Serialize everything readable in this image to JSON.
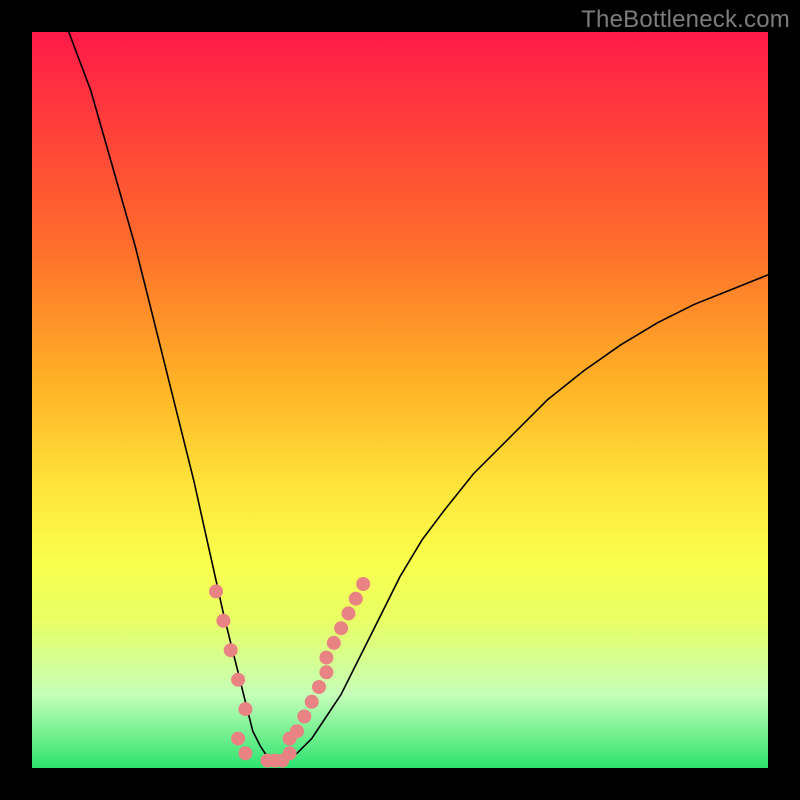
{
  "watermark": "TheBottleneck.com",
  "chart_data": {
    "type": "line",
    "title": "",
    "xlabel": "",
    "ylabel": "",
    "xlim": [
      0,
      100
    ],
    "ylim": [
      0,
      100
    ],
    "curve": {
      "name": "bottleneck-curve",
      "x": [
        5,
        8,
        10,
        12,
        14,
        16,
        18,
        20,
        22,
        24,
        26,
        27,
        28,
        29,
        30,
        31,
        32,
        33,
        34,
        35,
        36,
        38,
        40,
        42,
        44,
        46,
        48,
        50,
        53,
        56,
        60,
        65,
        70,
        75,
        80,
        85,
        90,
        95,
        100
      ],
      "y": [
        100,
        92,
        85,
        78,
        71,
        63,
        55,
        47,
        39,
        30,
        21,
        17,
        13,
        9,
        5,
        3,
        1.5,
        1,
        1,
        1.3,
        2,
        4,
        7,
        10,
        14,
        18,
        22,
        26,
        31,
        35,
        40,
        45,
        50,
        54,
        57.5,
        60.5,
        63,
        65,
        67
      ]
    },
    "markers": {
      "name": "salmon-dots",
      "color": "#e98383",
      "points_x": [
        25,
        26,
        27,
        28,
        29,
        28,
        29,
        32,
        33,
        34,
        35,
        35,
        36,
        37,
        38,
        39,
        40,
        40,
        41,
        42,
        43,
        44,
        45
      ],
      "points_y": [
        24,
        20,
        16,
        12,
        8,
        4,
        2,
        1,
        1,
        1,
        2,
        4,
        5,
        7,
        9,
        11,
        13,
        15,
        17,
        19,
        21,
        23,
        25
      ]
    }
  }
}
